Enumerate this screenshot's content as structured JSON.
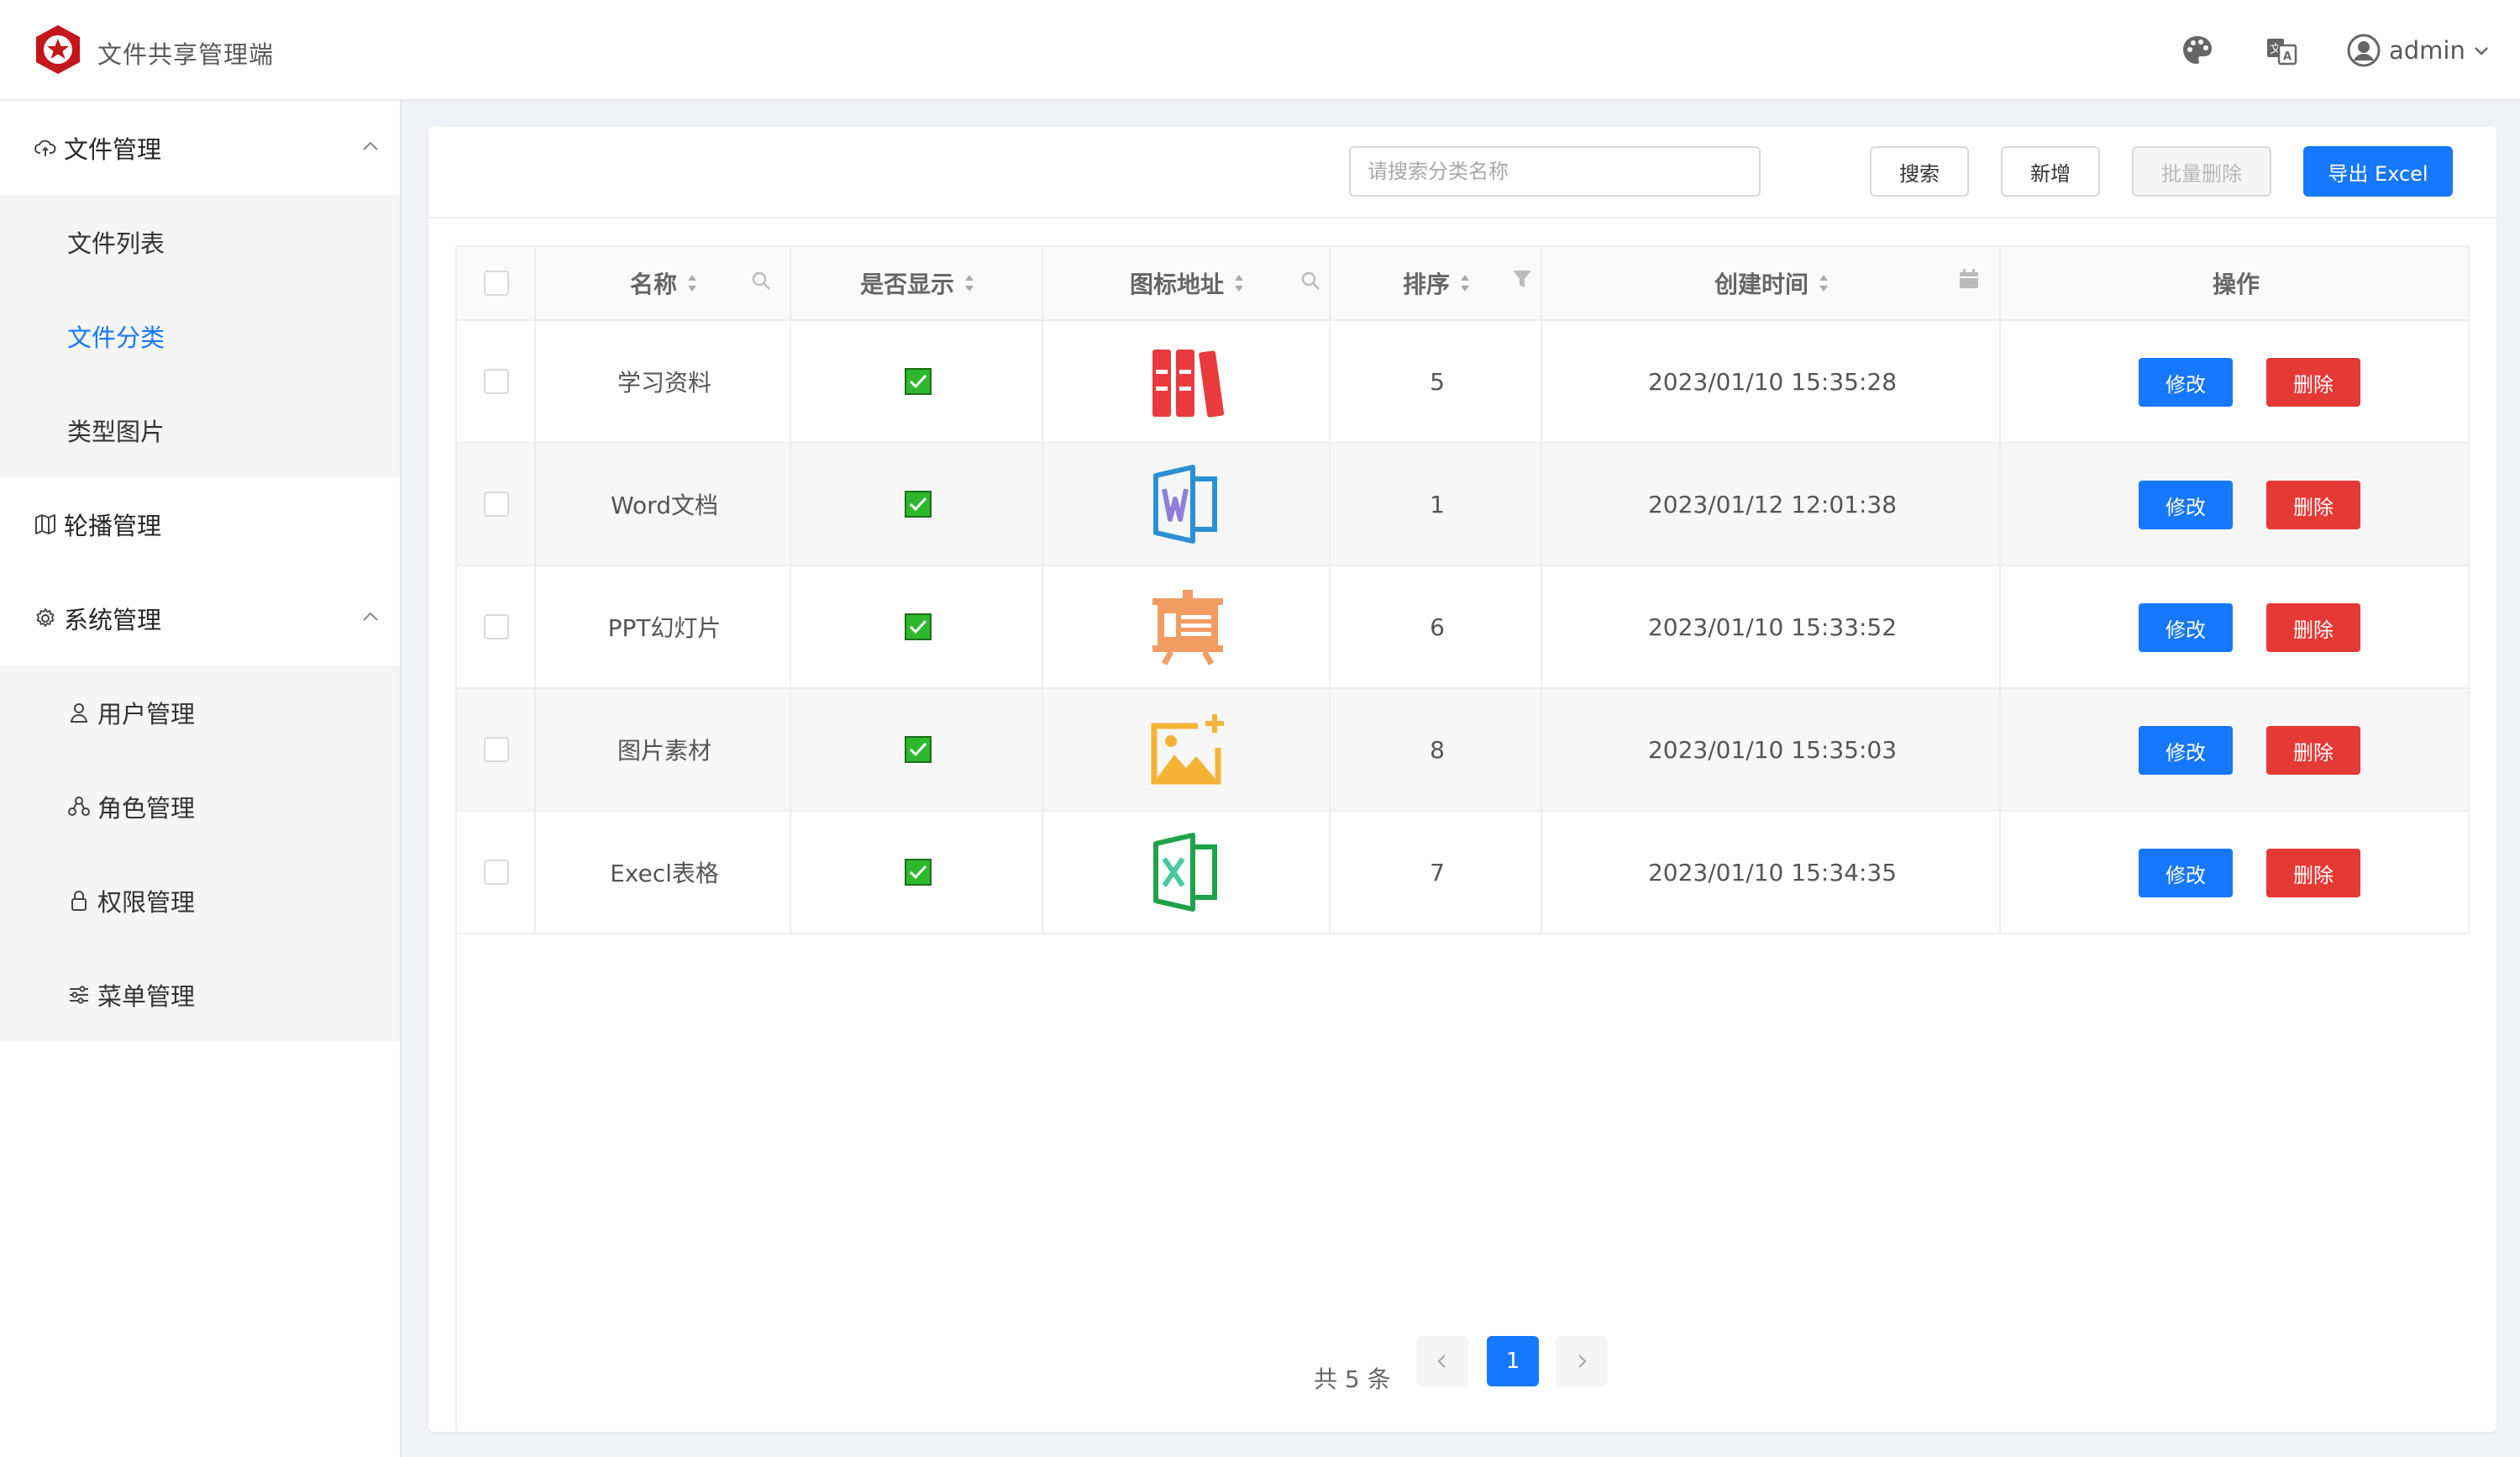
{
  "header": {
    "app_title": "文件共享管理端",
    "username": "admin"
  },
  "sidebar": {
    "groups": [
      {
        "label": "文件管理",
        "icon": "cloud-icon",
        "expanded": true,
        "items": [
          {
            "label": "文件列表"
          },
          {
            "label": "文件分类",
            "active": true
          },
          {
            "label": "类型图片"
          }
        ]
      },
      {
        "label": "轮播管理",
        "icon": "map-icon"
      },
      {
        "label": "系统管理",
        "icon": "gear-icon",
        "expanded": true,
        "items": [
          {
            "label": "用户管理",
            "icon": "user-icon"
          },
          {
            "label": "角色管理",
            "icon": "role-icon"
          },
          {
            "label": "权限管理",
            "icon": "lock-icon"
          },
          {
            "label": "菜单管理",
            "icon": "sliders-icon"
          }
        ]
      }
    ]
  },
  "toolbar": {
    "search_placeholder": "请搜索分类名称",
    "search_label": "搜索",
    "add_label": "新增",
    "batch_delete_label": "批量删除",
    "export_label": "导出 Excel"
  },
  "table": {
    "columns": [
      "名称",
      "是否显示",
      "图标地址",
      "排序",
      "创建时间",
      "操作"
    ],
    "rows": [
      {
        "name": "学习资料",
        "shown": true,
        "icon": "books-icon",
        "order": "5",
        "created": "2023/01/10 15:35:28"
      },
      {
        "name": "Word文档",
        "shown": true,
        "icon": "word-icon",
        "order": "1",
        "created": "2023/01/12 12:01:38"
      },
      {
        "name": "PPT幻灯片",
        "shown": true,
        "icon": "presentation-icon",
        "order": "6",
        "created": "2023/01/10 15:33:52"
      },
      {
        "name": "图片素材",
        "shown": true,
        "icon": "image-icon",
        "order": "8",
        "created": "2023/01/10 15:35:03"
      },
      {
        "name": "Execl表格",
        "shown": true,
        "icon": "excel-icon",
        "order": "7",
        "created": "2023/01/10 15:34:35"
      }
    ],
    "edit_label": "修改",
    "delete_label": "删除"
  },
  "pagination": {
    "total_text": "共 5 条",
    "current_page": "1"
  },
  "colors": {
    "primary": "#1677ff",
    "danger": "#e53935",
    "check": "#2eb82e"
  }
}
